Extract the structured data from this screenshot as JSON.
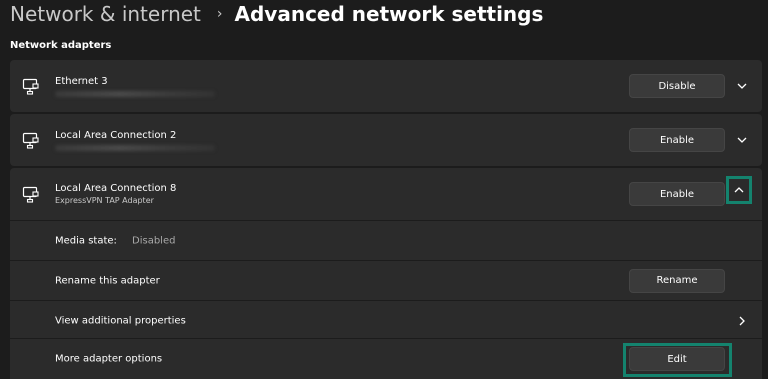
{
  "header": {
    "parent": "Network & internet",
    "separator": "›",
    "current": "Advanced network settings"
  },
  "section": {
    "title": "Network adapters"
  },
  "adapters": [
    {
      "name": "Ethernet 3",
      "button_label": "Disable",
      "expanded": false
    },
    {
      "name": "Local Area Connection 2",
      "button_label": "Enable",
      "expanded": false
    },
    {
      "name": "Local Area Connection 8",
      "description": "ExpressVPN TAP Adapter",
      "button_label": "Enable",
      "expanded": true
    }
  ],
  "details": {
    "media_state_label": "Media state:",
    "media_state_value": "Disabled",
    "rename_label": "Rename this adapter",
    "rename_button": "Rename",
    "properties_label": "View additional properties",
    "more_options_label": "More adapter options",
    "edit_button": "Edit"
  },
  "colors": {
    "background": "#1c1c1c",
    "card": "#2b2b2b",
    "button": "#3a3a3a",
    "highlight": "#14836e"
  },
  "icons": {
    "adapter": "network-adapter-icon",
    "expand": "chevron-down-icon",
    "collapse": "chevron-up-icon",
    "navigate": "chevron-right-icon"
  }
}
